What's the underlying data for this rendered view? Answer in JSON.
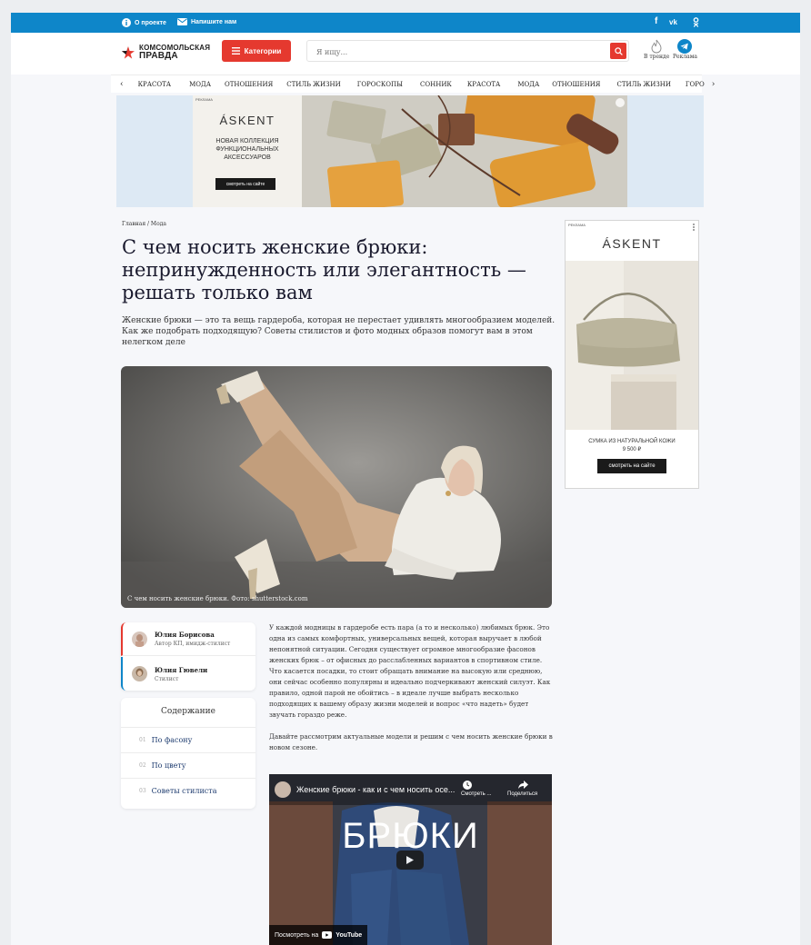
{
  "topbar": {
    "about": "О проекте",
    "write": "Напишите нам",
    "social": [
      "f",
      "vk",
      "ok"
    ]
  },
  "header": {
    "logo_line1": "КОМСОМОЛЬСКАЯ",
    "logo_line2": "ПРАВДА",
    "categories": "Категории",
    "search_placeholder": "Я ищу...",
    "trending": "В тренде",
    "ads": "Реклама"
  },
  "nav": {
    "prev": "‹",
    "next": "›",
    "items": [
      "КРАСОТА",
      "МОДА",
      "ОТНОШЕНИЯ",
      "СТИЛЬ ЖИЗНИ",
      "ГОРОСКОПЫ",
      "СОННИК",
      "КРАСОТА",
      "МОДА",
      "ОТНОШЕНИЯ",
      "СТИЛЬ ЖИЗНИ",
      "ГОРО"
    ]
  },
  "top_ad": {
    "label": "РЕКЛАМА",
    "brand": "ÁSKENT",
    "line1": "НОВАЯ КОЛЛЕКЦИЯ",
    "line2": "ФУНКЦИОНАЛЬНЫХ",
    "line3": "АКСЕССУАРОВ",
    "cta": "смотреть на сайте"
  },
  "side_ad": {
    "label": "РЕКЛАМА",
    "brand": "ÁSKENT",
    "product": "СУМКА ИЗ НАТУРАЛЬНОЙ КОЖИ",
    "price": "9 500 ₽",
    "cta": "смотреть на сайте"
  },
  "article": {
    "breadcrumb": "Главная / Мода",
    "title": "С чем носить женские брюки: непринужденность или элегантность — решать только вам",
    "lead": "Женские брюки — это та вещь гардероба, которая не перестает удивлять многообразием моделей. Как же подобрать подходящую? Советы стилистов и фото модных образов помогут вам в этом нелегком деле",
    "hero_caption": "С чем носить женские брюки. Фото: shutterstock.com",
    "body_p1": "У каждой модницы в гардеробе есть пара (а то и несколько) любимых брюк. Это одна из самых комфортных, универсальных вещей, которая выручает в любой непонятной ситуации. Сегодня существует огромное многообразие фасонов женских брюк – от офисных до расслабленных вариантов в спортивном стиле. Что касается посадки, то стоит обращать внимание на высокую или среднюю, они сейчас особенно популярны и идеально подчеркивают женский силуэт. Как правило, одной парой не обойтись – в идеале лучше выбрать несколько подходящих к вашему образу жизни моделей и вопрос «что надеть» будет звучать гораздо реже.",
    "body_p2": "Давайте рассмотрим актуальные модели и решим с чем носить женские брюки в новом сезоне."
  },
  "authors": [
    {
      "name": "Юлия Борисова",
      "role": "Автор КП, имидж-стилист"
    },
    {
      "name": "Юлия Гювели",
      "role": "Стилист"
    }
  ],
  "toc": {
    "title": "Содержание",
    "items": [
      {
        "num": "01",
        "label": "По фасону"
      },
      {
        "num": "02",
        "label": "По цвету"
      },
      {
        "num": "03",
        "label": "Советы стилиста"
      }
    ]
  },
  "video": {
    "title": "Женские брюки - как и с чем носить осе...",
    "watch_later": "Смотреть ...",
    "share": "Поделиться",
    "big_text": "БРЮКИ",
    "watch_on": "Посмотреть на",
    "youtube": "YouTube"
  },
  "colors": {
    "topbar": "#0e86c9",
    "accent": "#e5392f",
    "title": "#1a1a2e"
  }
}
